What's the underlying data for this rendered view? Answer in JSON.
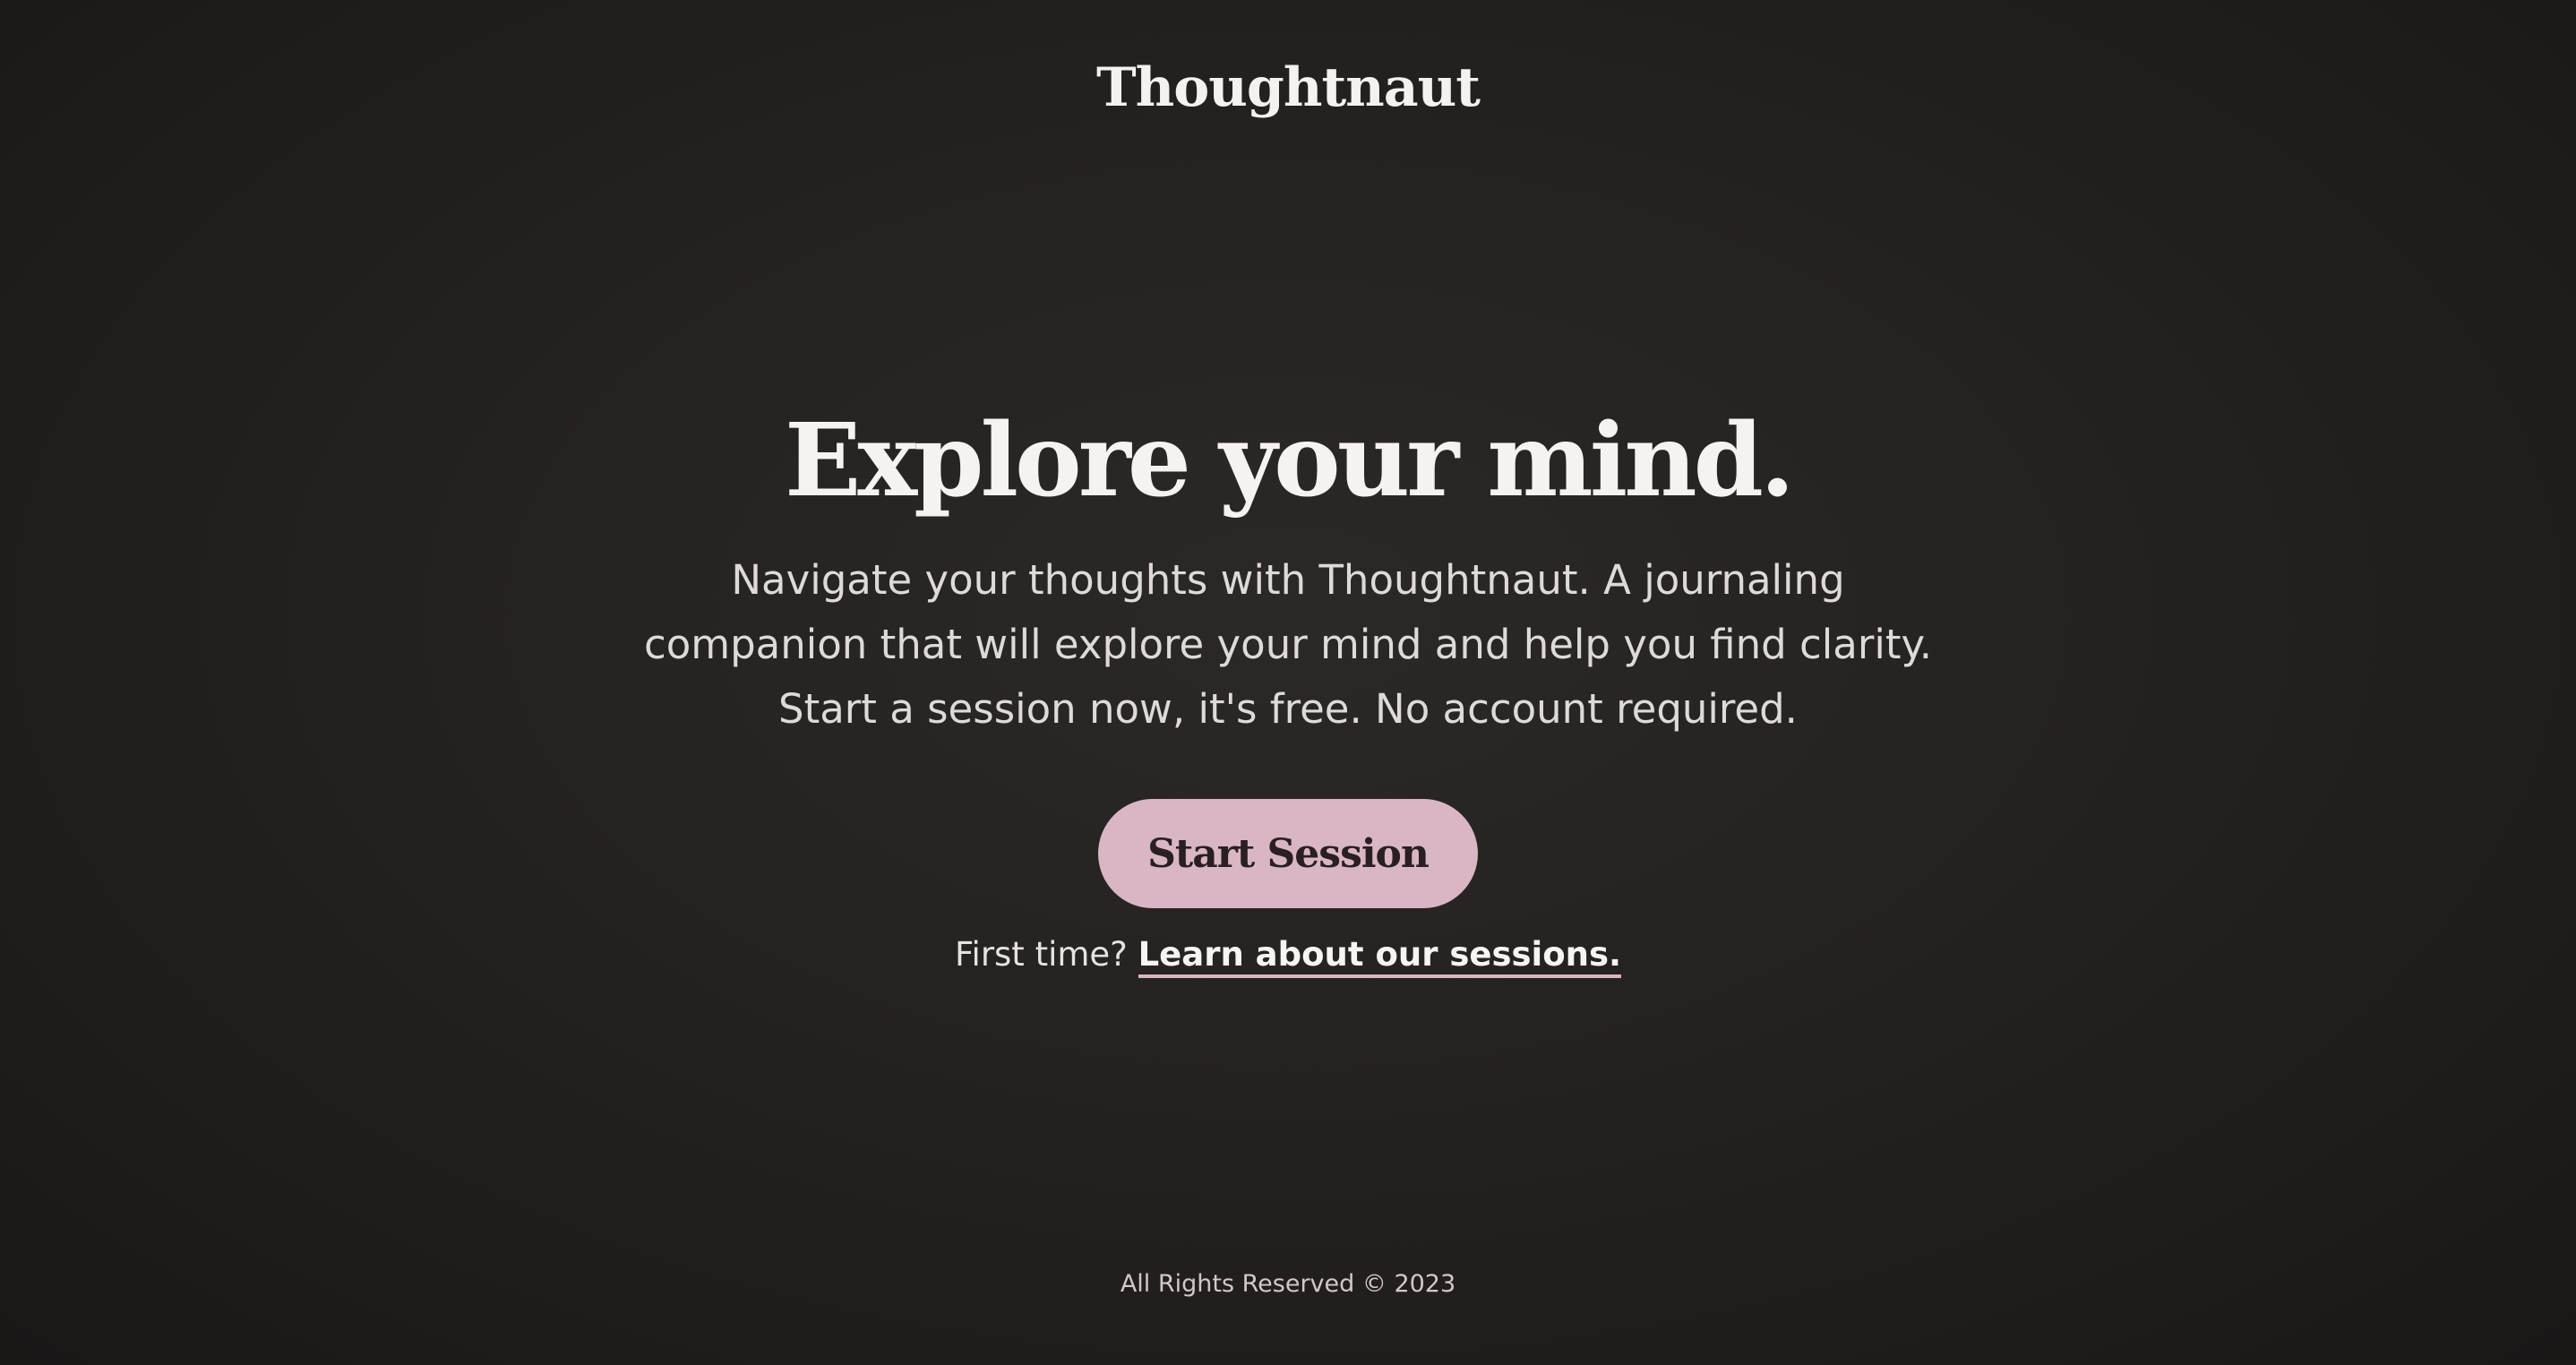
{
  "header": {
    "brand": "Thoughtnaut"
  },
  "hero": {
    "headline": "Explore your mind.",
    "subhead_lines": [
      "Navigate your thoughts with Thoughtnaut. A journaling",
      "companion that will explore your mind and help you find clarity.",
      "Start a session now, it's free. No account required."
    ],
    "cta_label": "Start Session",
    "first_time_prefix": "First time?",
    "learn_link": "Learn about our sessions."
  },
  "footer": {
    "text": "All Rights Reserved © 2023"
  },
  "colors": {
    "background": "#262221",
    "accent": "#d9b6c3",
    "text": "#f5f2f0"
  }
}
